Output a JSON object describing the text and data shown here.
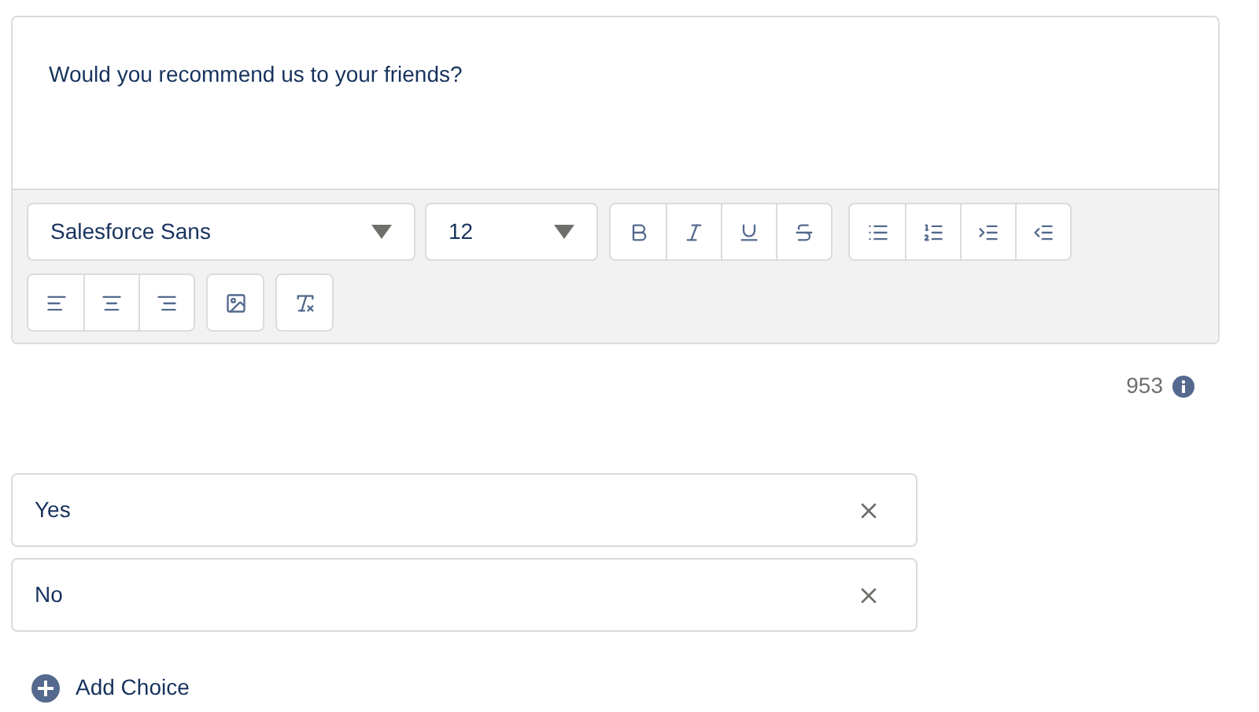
{
  "editor": {
    "value": "Would you recommend us to your friends?",
    "font_select": {
      "value": "Salesforce Sans"
    },
    "size_select": {
      "value": "12"
    },
    "toolbar_rows": [
      {
        "groups": [
          {
            "buttons": [
              {
                "kind": "bold"
              },
              {
                "kind": "italic"
              },
              {
                "kind": "underline"
              },
              {
                "kind": "strike"
              }
            ]
          },
          {
            "buttons": [
              {
                "kind": "bullets"
              },
              {
                "kind": "numbers"
              },
              {
                "kind": "indent"
              },
              {
                "kind": "outdent"
              }
            ]
          }
        ]
      },
      {
        "groups": [
          {
            "buttons": [
              {
                "kind": "align-left"
              },
              {
                "kind": "align-center"
              },
              {
                "kind": "align-right"
              }
            ]
          },
          {
            "buttons": [
              {
                "kind": "image"
              }
            ]
          },
          {
            "buttons": [
              {
                "kind": "clear-format"
              }
            ]
          }
        ]
      }
    ]
  },
  "char_count": "953",
  "choices": [
    {
      "value": "Yes"
    },
    {
      "value": "No"
    }
  ],
  "add_choice": "Add Choice"
}
